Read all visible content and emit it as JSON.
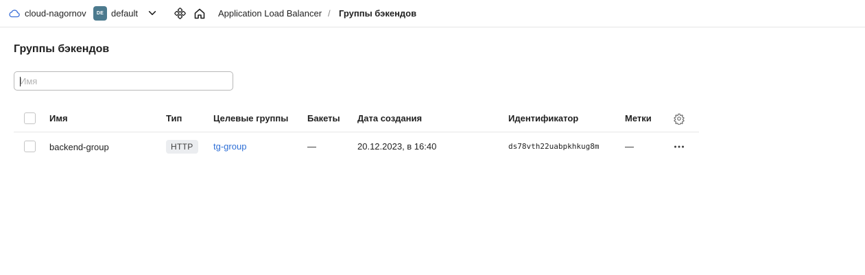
{
  "topbar": {
    "cloud_name": "cloud-nagornov",
    "folder_badge": "DE",
    "folder_name": "default",
    "breadcrumb_service": "Application Load Balancer",
    "breadcrumb_separator": "/",
    "breadcrumb_current": "Группы бэкендов"
  },
  "page": {
    "title": "Группы бэкендов"
  },
  "search": {
    "placeholder": "Имя",
    "value": ""
  },
  "table": {
    "columns": {
      "name": "Имя",
      "type": "Тип",
      "target_groups": "Целевые группы",
      "buckets": "Бакеты",
      "created": "Дата создания",
      "id": "Идентификатор",
      "labels": "Метки"
    },
    "rows": [
      {
        "name": "backend-group",
        "type": "HTTP",
        "target_groups": "tg-group",
        "buckets": "—",
        "created": "20.12.2023, в 16:40",
        "id": "ds78vth22uabpkhkug8m",
        "labels": "—"
      }
    ]
  },
  "colors": {
    "accent_link": "#2e6fd6",
    "folder_badge_bg": "#4c7a8e",
    "cloud_icon": "#3b6fd8"
  },
  "icons": {
    "cloud": "cloud-icon",
    "chevron": "chevron-down-icon",
    "services": "services-icon",
    "home": "home-icon",
    "settings": "gear-icon",
    "more": "more-icon"
  }
}
